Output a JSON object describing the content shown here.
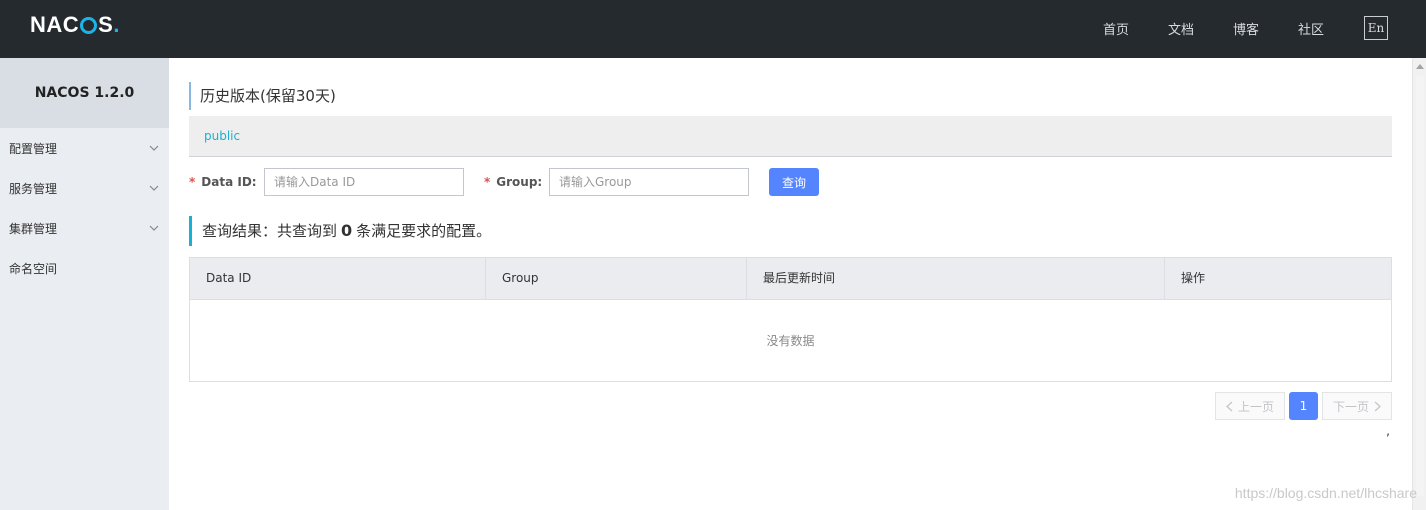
{
  "header": {
    "logo_text": "NACOS",
    "nav": [
      "首页",
      "文档",
      "博客",
      "社区"
    ],
    "lang_button": "En"
  },
  "sidebar": {
    "version": "NACOS 1.2.0",
    "items": [
      {
        "label": "配置管理",
        "expandable": true
      },
      {
        "label": "服务管理",
        "expandable": true
      },
      {
        "label": "集群管理",
        "expandable": true
      },
      {
        "label": "命名空间",
        "expandable": false
      }
    ]
  },
  "main": {
    "title": "历史版本(保留30天)",
    "namespace": "public",
    "form": {
      "data_id_label": "Data ID:",
      "data_id_placeholder": "请输入Data ID",
      "data_id_value": "",
      "group_label": "Group:",
      "group_placeholder": "请输入Group",
      "group_value": "",
      "query_button": "查询"
    },
    "result": {
      "prefix": "查询结果：共查询到",
      "count": "0",
      "suffix": "条满足要求的配置。"
    },
    "table": {
      "columns": [
        "Data ID",
        "Group",
        "最后更新时间",
        "操作"
      ],
      "rows": [],
      "empty_text": "没有数据"
    },
    "pagination": {
      "prev": "上一页",
      "current": "1",
      "next": "下一页"
    },
    "stray_mark": ","
  },
  "watermark": "https://blog.csdn.net/lhcshare",
  "colors": {
    "topbar_bg": "#252a2f",
    "accent": "#5584ff",
    "link": "#1ab0d4",
    "sidebar_bg": "#eaedf1"
  }
}
